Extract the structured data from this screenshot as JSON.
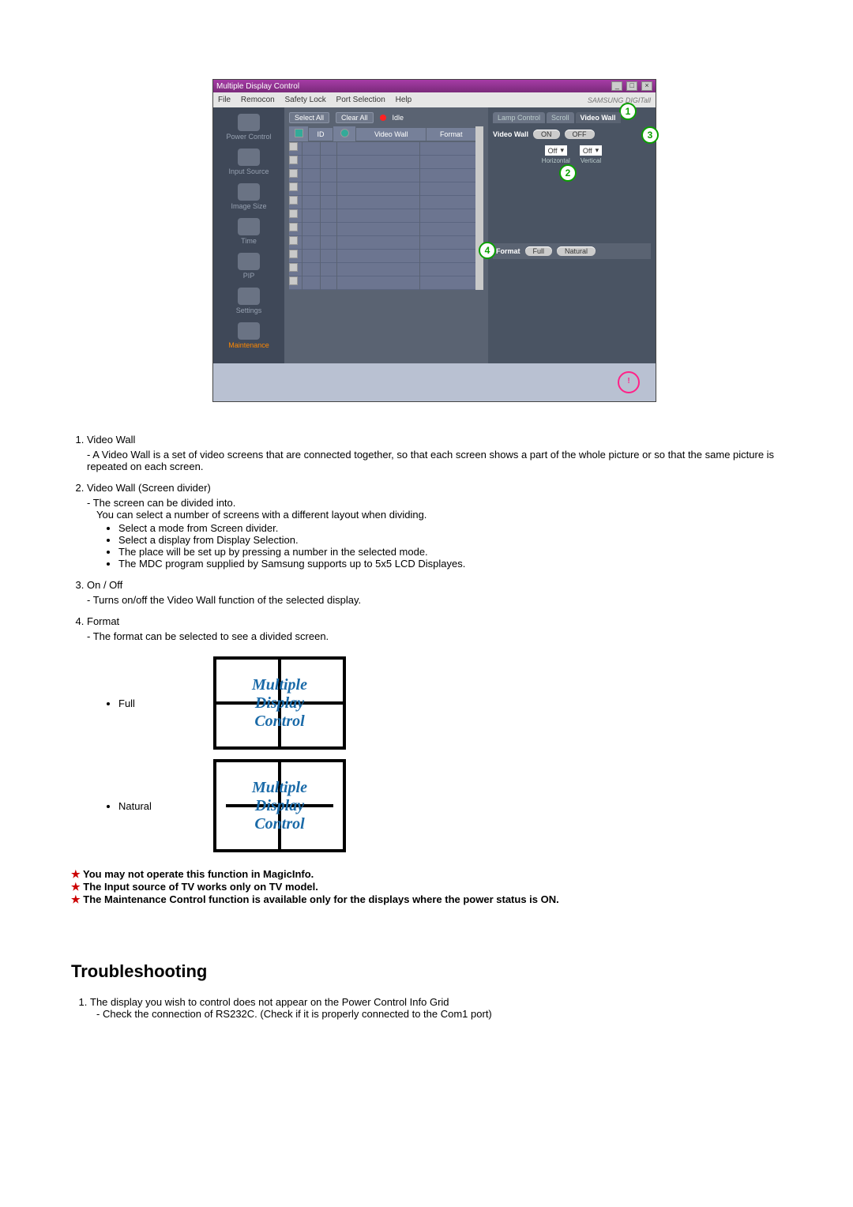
{
  "app": {
    "title": "Multiple Display Control",
    "menu": [
      "File",
      "Remocon",
      "Safety Lock",
      "Port Selection",
      "Help"
    ],
    "brand": "SAMSUNG DIGITall"
  },
  "sidebar": {
    "items": [
      {
        "label": "Power Control"
      },
      {
        "label": "Input Source"
      },
      {
        "label": "Image Size"
      },
      {
        "label": "Time"
      },
      {
        "label": "PIP"
      },
      {
        "label": "Settings"
      },
      {
        "label": "Maintenance"
      }
    ]
  },
  "toolbar": {
    "select_all": "Select All",
    "clear_all": "Clear All",
    "idle": "Idle"
  },
  "grid": {
    "headers": [
      "",
      "ID",
      "",
      "Video Wall",
      "Format"
    ]
  },
  "tabs": [
    "Lamp Control",
    "Scroll",
    "Video Wall"
  ],
  "panel": {
    "vw_label": "Video Wall",
    "on": "ON",
    "off": "OFF",
    "h_val": "Off",
    "v_val": "Off",
    "h_label": "Horizontal",
    "v_label": "Vertical",
    "format_label": "Format",
    "full": "Full",
    "natural": "Natural"
  },
  "badges": {
    "b1": "1",
    "b2": "2",
    "b3": "3",
    "b4": "4"
  },
  "desc": {
    "i1": {
      "title": "Video Wall",
      "d1": "A Video Wall is a set of video screens that are connected together, so that each screen shows a part of the whole picture or so that the same picture is repeated on each screen."
    },
    "i2": {
      "title": "Video Wall (Screen divider)",
      "d1": "The screen can be divided into.",
      "d2": "You can select a number of screens with a different layout when dividing.",
      "b": [
        "Select a mode from Screen divider.",
        "Select a display from Display Selection.",
        "The place will be set up by pressing a number in the selected mode.",
        "The MDC program supplied by Samsung supports up to 5x5 LCD Displayes."
      ]
    },
    "i3": {
      "title": "On / Off",
      "d1": "Turns on/off the Video Wall function of the selected display."
    },
    "i4": {
      "title": "Format",
      "d1": "The format can be selected to see a divided screen."
    },
    "samples": {
      "full": "Full",
      "natural": "Natural",
      "line1": "Multiple",
      "line2": "Display",
      "line3": "Control"
    }
  },
  "notes": [
    "You may not operate this function in MagicInfo.",
    "The Input source of TV works only on TV model.",
    "The Maintenance Control function is available only for the displays where the power status is ON."
  ],
  "troubleshooting": {
    "heading": "Troubleshooting",
    "i1": "The display you wish to control does not appear on the Power Control Info Grid",
    "i1d": "Check the connection of RS232C. (Check if it is properly connected to the Com1 port)"
  }
}
